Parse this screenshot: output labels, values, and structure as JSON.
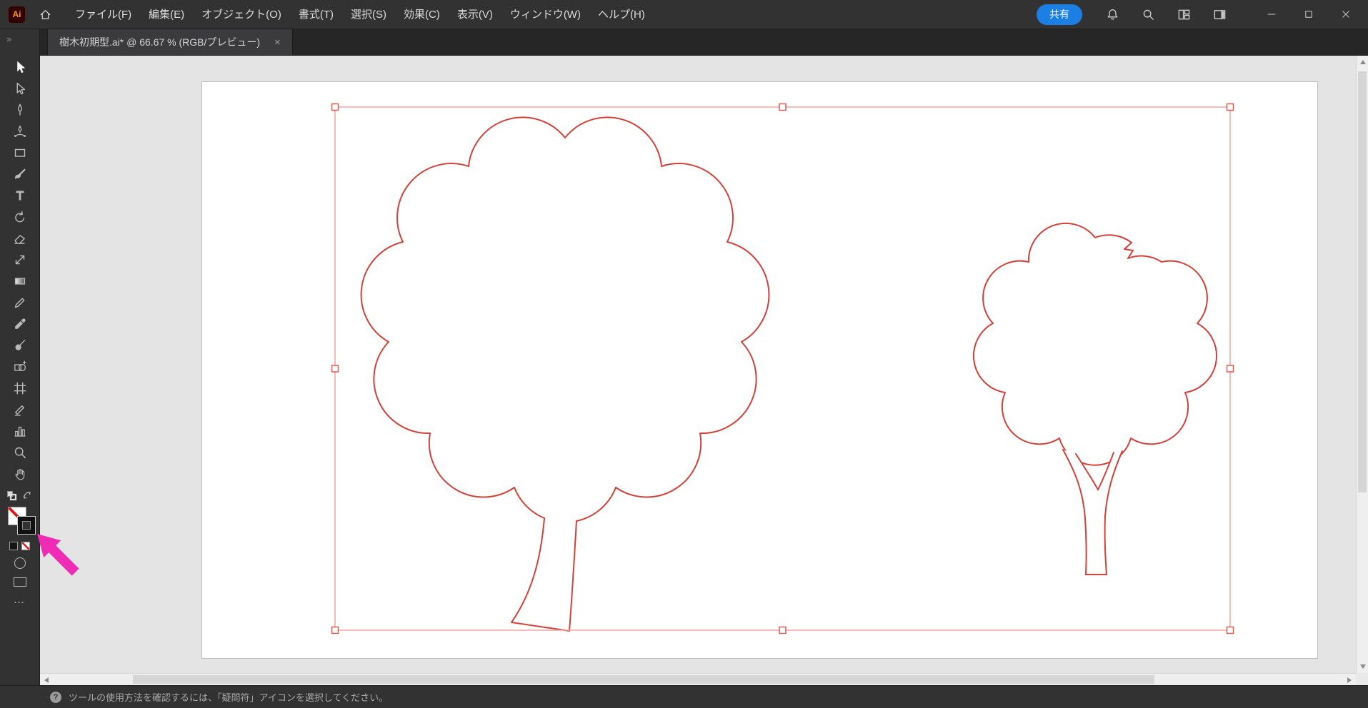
{
  "app": {
    "logo_text": "Ai",
    "menu_items": [
      "ファイル(F)",
      "編集(E)",
      "オブジェクト(O)",
      "書式(T)",
      "選択(S)",
      "効果(C)",
      "表示(V)",
      "ウィンドウ(W)",
      "ヘルプ(H)"
    ],
    "share_label": "共有",
    "header_icons": [
      "home-icon",
      "notifications-bell-icon",
      "search-icon",
      "workspace-grid-icon",
      "panel-layout-icon"
    ],
    "window_controls": [
      "minimize-icon",
      "maximize-icon",
      "close-icon"
    ]
  },
  "document_tab": {
    "title": "樹木初期型.ai* @ 66.67 % (RGB/プレビュー)",
    "close_glyph": "×"
  },
  "toolbar": {
    "expand_glyph": "»",
    "more_glyph": "…",
    "tools": [
      "selection-tool",
      "direct-selection-tool",
      "pen-tool",
      "curvature-tool",
      "rectangle-tool",
      "paintbrush-tool",
      "type-tool",
      "rotate-tool",
      "eraser-tool",
      "scale-tool",
      "gradient-tool",
      "pencil-tool",
      "eyedropper-tool",
      "blob-brush-tool",
      "shape-builder-tool",
      "artboard-tool",
      "slice-tool",
      "column-graph-tool",
      "zoom-tool",
      "hand-tool"
    ],
    "active_tool": "selection-tool",
    "fill_indicator": "none",
    "stroke_indicator": "color"
  },
  "canvas_content": {
    "artwork": [
      "large-tree-outline",
      "small-tree-outline"
    ],
    "selection_handle_count": 8
  },
  "statusbar": {
    "icon_glyph": "?",
    "help_text": "ツールの使用方法を確認するには、「疑問符」アイコンを選択してください。"
  },
  "colors": {
    "accent_blue": "#1b7fe3",
    "tree_stroke": "#d3423a",
    "selection_line": "#f2a3a3",
    "handle_border": "#e05a52",
    "annotation_magenta": "#ee2cb5",
    "chrome": "#323233",
    "chrome_dark": "#262627",
    "tab_bg": "#3b3b3d",
    "pasteboard": "#e4e4e4",
    "artboard_bg": "#ffffff",
    "none_slash_red": "#e01b1b"
  }
}
